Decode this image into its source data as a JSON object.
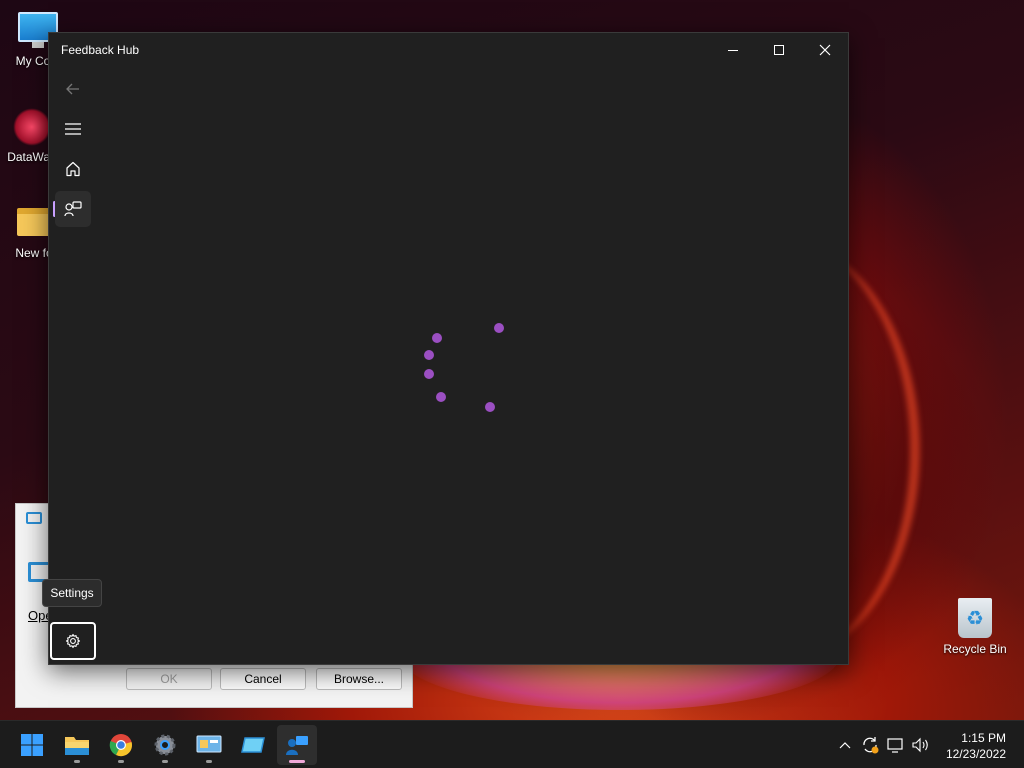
{
  "desktop": {
    "icons": [
      {
        "label": "My Com",
        "icon": "computer-icon"
      },
      {
        "label": "DataWag",
        "icon": "datawag-shortcut-icon"
      },
      {
        "label": "New fo",
        "icon": "folder-icon"
      },
      {
        "label": "Recycle Bin",
        "icon": "recycle-bin-icon"
      }
    ]
  },
  "dialog": {
    "open_label": "Ope",
    "buttons": {
      "ok": "OK",
      "cancel": "Cancel",
      "browse": "Browse..."
    }
  },
  "window": {
    "title": "Feedback Hub",
    "nav": {
      "back": "back-arrow-icon",
      "menu": "hamburger-menu-icon",
      "home": "home-icon",
      "feedback": "feedback-icon",
      "settings": "gear-icon"
    },
    "tooltip": "Settings",
    "loading": {
      "state": "loading",
      "color": "#9b4fc2"
    }
  },
  "taskbar": {
    "apps": [
      {
        "name": "start-button",
        "icon": "windows-logo-icon"
      },
      {
        "name": "file-explorer",
        "icon": "folder-icon"
      },
      {
        "name": "chrome",
        "icon": "chrome-icon"
      },
      {
        "name": "settings",
        "icon": "gear-icon"
      },
      {
        "name": "control-panel",
        "icon": "control-panel-icon"
      },
      {
        "name": "remote-app",
        "icon": "monitor-icon"
      },
      {
        "name": "feedback-hub",
        "icon": "feedback-hub-icon"
      }
    ],
    "clock": {
      "time": "1:15 PM",
      "date": "12/23/2022"
    }
  },
  "colors": {
    "accent": "#c9a0ff",
    "spinner": "#9b4fc2",
    "window_bg": "#202020"
  }
}
